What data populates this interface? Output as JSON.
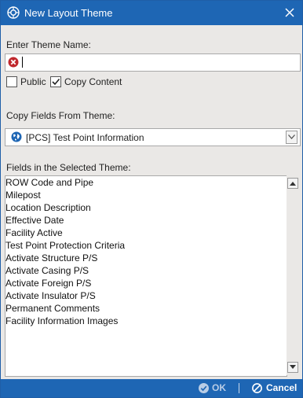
{
  "window": {
    "title": "New Layout Theme"
  },
  "theme_name": {
    "label": "Enter Theme Name:",
    "value": "",
    "placeholder": ""
  },
  "options": {
    "public_label": "Public",
    "public_checked": false,
    "copy_content_label": "Copy Content",
    "copy_content_checked": true
  },
  "copy_from": {
    "label": "Copy Fields From Theme:",
    "selected": "[PCS] Test Point Information"
  },
  "fields": {
    "label": "Fields in the Selected Theme:",
    "items": [
      "ROW Code and Pipe",
      "Milepost",
      "Location Description",
      "Effective Date",
      "Facility Active",
      "Test Point Protection Criteria",
      "Activate Structure P/S",
      "Activate Casing P/S",
      "Activate Foreign P/S",
      "Activate Insulator P/S",
      "Permanent Comments",
      "Facility Information Images"
    ]
  },
  "footer": {
    "ok_label": "OK",
    "cancel_label": "Cancel"
  },
  "colors": {
    "titlebar": "#1e66b4",
    "error": "#c0282d",
    "globe": "#1e66b4"
  }
}
